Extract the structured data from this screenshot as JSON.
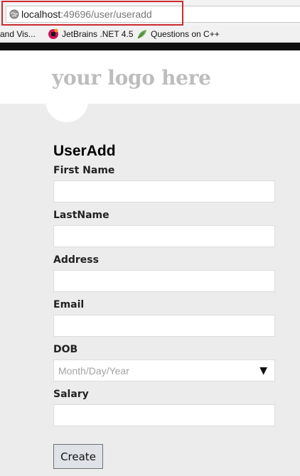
{
  "browser": {
    "url_host": "localhost",
    "url_path": ":49696/user/useradd",
    "bookmarks": [
      {
        "label": "and Vis...",
        "icon": "bookmark-folder-icon"
      },
      {
        "label": "JetBrains .NET 4.5",
        "icon": "jetbrains-icon"
      },
      {
        "label": "Questions on C++",
        "icon": "leaf-icon"
      }
    ]
  },
  "header": {
    "logo_text": "your logo here"
  },
  "form": {
    "title": "UserAdd",
    "fields": [
      {
        "label": "First Name",
        "value": ""
      },
      {
        "label": "LastName",
        "value": ""
      },
      {
        "label": "Address",
        "value": ""
      },
      {
        "label": "Email",
        "value": ""
      },
      {
        "label": "DOB",
        "placeholder": "Month/Day/Year",
        "type": "date"
      },
      {
        "label": "Salary",
        "value": ""
      }
    ],
    "submit_label": "Create"
  },
  "colors": {
    "highlight_border": "#cc2a2f",
    "page_background": "#ececec",
    "logo_text": "#bdbdbd"
  }
}
